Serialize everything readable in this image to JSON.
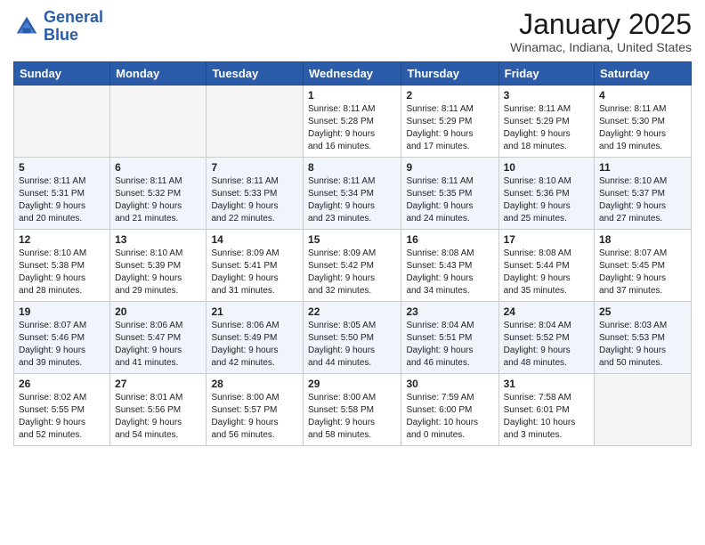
{
  "logo": {
    "line1": "General",
    "line2": "Blue"
  },
  "title": "January 2025",
  "subtitle": "Winamac, Indiana, United States",
  "days_header": [
    "Sunday",
    "Monday",
    "Tuesday",
    "Wednesday",
    "Thursday",
    "Friday",
    "Saturday"
  ],
  "weeks": [
    [
      {
        "day": "",
        "info": ""
      },
      {
        "day": "",
        "info": ""
      },
      {
        "day": "",
        "info": ""
      },
      {
        "day": "1",
        "info": "Sunrise: 8:11 AM\nSunset: 5:28 PM\nDaylight: 9 hours\nand 16 minutes."
      },
      {
        "day": "2",
        "info": "Sunrise: 8:11 AM\nSunset: 5:29 PM\nDaylight: 9 hours\nand 17 minutes."
      },
      {
        "day": "3",
        "info": "Sunrise: 8:11 AM\nSunset: 5:29 PM\nDaylight: 9 hours\nand 18 minutes."
      },
      {
        "day": "4",
        "info": "Sunrise: 8:11 AM\nSunset: 5:30 PM\nDaylight: 9 hours\nand 19 minutes."
      }
    ],
    [
      {
        "day": "5",
        "info": "Sunrise: 8:11 AM\nSunset: 5:31 PM\nDaylight: 9 hours\nand 20 minutes."
      },
      {
        "day": "6",
        "info": "Sunrise: 8:11 AM\nSunset: 5:32 PM\nDaylight: 9 hours\nand 21 minutes."
      },
      {
        "day": "7",
        "info": "Sunrise: 8:11 AM\nSunset: 5:33 PM\nDaylight: 9 hours\nand 22 minutes."
      },
      {
        "day": "8",
        "info": "Sunrise: 8:11 AM\nSunset: 5:34 PM\nDaylight: 9 hours\nand 23 minutes."
      },
      {
        "day": "9",
        "info": "Sunrise: 8:11 AM\nSunset: 5:35 PM\nDaylight: 9 hours\nand 24 minutes."
      },
      {
        "day": "10",
        "info": "Sunrise: 8:10 AM\nSunset: 5:36 PM\nDaylight: 9 hours\nand 25 minutes."
      },
      {
        "day": "11",
        "info": "Sunrise: 8:10 AM\nSunset: 5:37 PM\nDaylight: 9 hours\nand 27 minutes."
      }
    ],
    [
      {
        "day": "12",
        "info": "Sunrise: 8:10 AM\nSunset: 5:38 PM\nDaylight: 9 hours\nand 28 minutes."
      },
      {
        "day": "13",
        "info": "Sunrise: 8:10 AM\nSunset: 5:39 PM\nDaylight: 9 hours\nand 29 minutes."
      },
      {
        "day": "14",
        "info": "Sunrise: 8:09 AM\nSunset: 5:41 PM\nDaylight: 9 hours\nand 31 minutes."
      },
      {
        "day": "15",
        "info": "Sunrise: 8:09 AM\nSunset: 5:42 PM\nDaylight: 9 hours\nand 32 minutes."
      },
      {
        "day": "16",
        "info": "Sunrise: 8:08 AM\nSunset: 5:43 PM\nDaylight: 9 hours\nand 34 minutes."
      },
      {
        "day": "17",
        "info": "Sunrise: 8:08 AM\nSunset: 5:44 PM\nDaylight: 9 hours\nand 35 minutes."
      },
      {
        "day": "18",
        "info": "Sunrise: 8:07 AM\nSunset: 5:45 PM\nDaylight: 9 hours\nand 37 minutes."
      }
    ],
    [
      {
        "day": "19",
        "info": "Sunrise: 8:07 AM\nSunset: 5:46 PM\nDaylight: 9 hours\nand 39 minutes."
      },
      {
        "day": "20",
        "info": "Sunrise: 8:06 AM\nSunset: 5:47 PM\nDaylight: 9 hours\nand 41 minutes."
      },
      {
        "day": "21",
        "info": "Sunrise: 8:06 AM\nSunset: 5:49 PM\nDaylight: 9 hours\nand 42 minutes."
      },
      {
        "day": "22",
        "info": "Sunrise: 8:05 AM\nSunset: 5:50 PM\nDaylight: 9 hours\nand 44 minutes."
      },
      {
        "day": "23",
        "info": "Sunrise: 8:04 AM\nSunset: 5:51 PM\nDaylight: 9 hours\nand 46 minutes."
      },
      {
        "day": "24",
        "info": "Sunrise: 8:04 AM\nSunset: 5:52 PM\nDaylight: 9 hours\nand 48 minutes."
      },
      {
        "day": "25",
        "info": "Sunrise: 8:03 AM\nSunset: 5:53 PM\nDaylight: 9 hours\nand 50 minutes."
      }
    ],
    [
      {
        "day": "26",
        "info": "Sunrise: 8:02 AM\nSunset: 5:55 PM\nDaylight: 9 hours\nand 52 minutes."
      },
      {
        "day": "27",
        "info": "Sunrise: 8:01 AM\nSunset: 5:56 PM\nDaylight: 9 hours\nand 54 minutes."
      },
      {
        "day": "28",
        "info": "Sunrise: 8:00 AM\nSunset: 5:57 PM\nDaylight: 9 hours\nand 56 minutes."
      },
      {
        "day": "29",
        "info": "Sunrise: 8:00 AM\nSunset: 5:58 PM\nDaylight: 9 hours\nand 58 minutes."
      },
      {
        "day": "30",
        "info": "Sunrise: 7:59 AM\nSunset: 6:00 PM\nDaylight: 10 hours\nand 0 minutes."
      },
      {
        "day": "31",
        "info": "Sunrise: 7:58 AM\nSunset: 6:01 PM\nDaylight: 10 hours\nand 3 minutes."
      },
      {
        "day": "",
        "info": ""
      }
    ]
  ]
}
